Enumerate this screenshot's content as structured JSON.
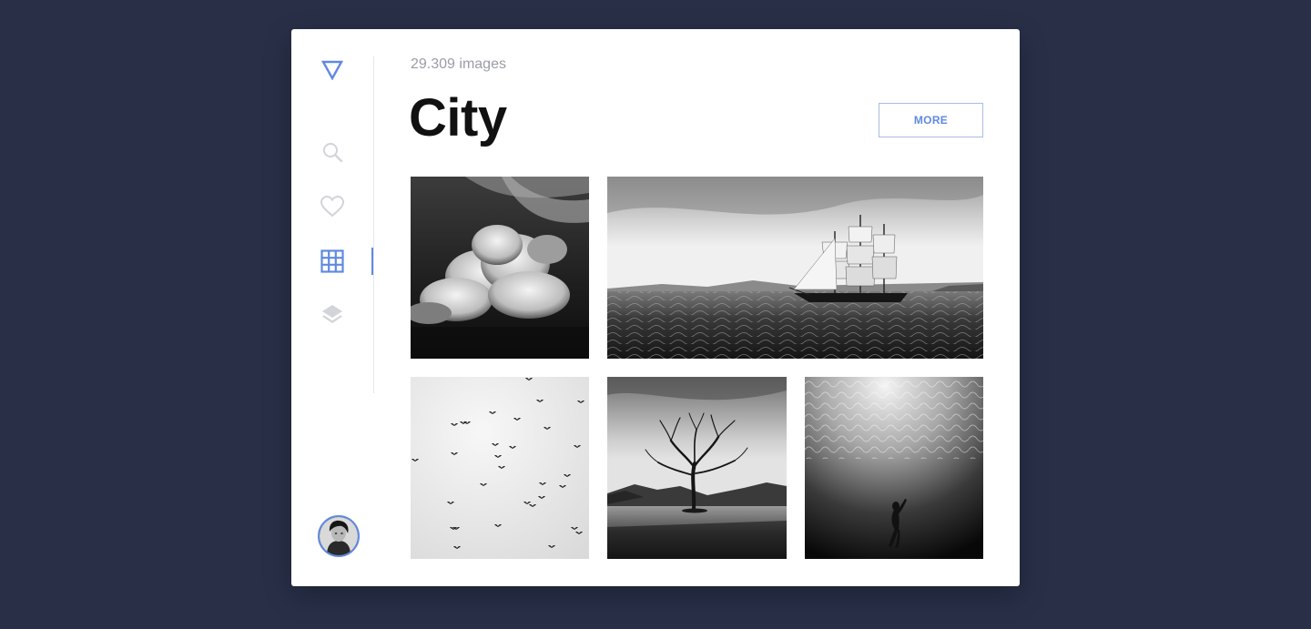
{
  "theme": {
    "accent": "#5f8ae0",
    "background": "#282f47",
    "card": "#ffffff"
  },
  "sidebar": {
    "logo_icon": "triangle-logo-icon",
    "items": [
      {
        "icon": "search-icon",
        "active": false
      },
      {
        "icon": "heart-icon",
        "active": false
      },
      {
        "icon": "grid-icon",
        "active": true
      },
      {
        "icon": "layers-icon",
        "active": false
      }
    ],
    "avatar": "user-avatar"
  },
  "main": {
    "count_text": "29.309 images",
    "title": "City",
    "more_label": "MORE"
  },
  "gallery": [
    {
      "subject": "clouds"
    },
    {
      "subject": "sailing-ship"
    },
    {
      "subject": "birds"
    },
    {
      "subject": "lone-tree"
    },
    {
      "subject": "underwater-diver"
    }
  ]
}
